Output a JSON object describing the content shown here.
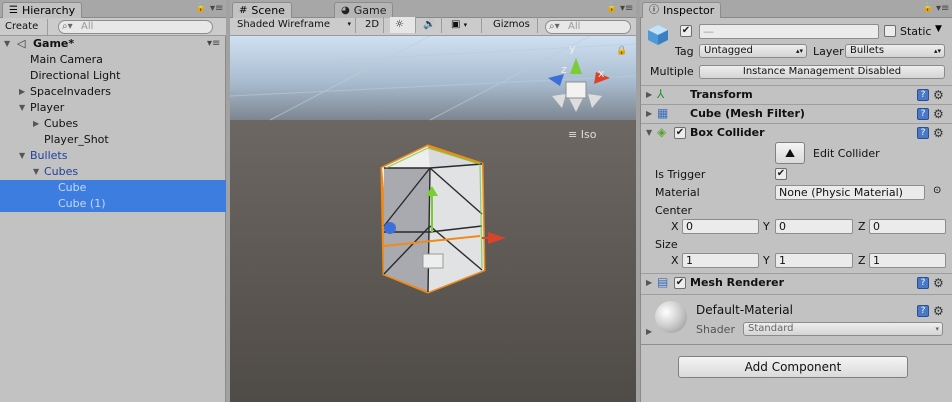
{
  "hierarchy": {
    "tab_label": "Hierarchy",
    "create_label": "Create",
    "search_placeholder": "All",
    "scene_name": "Game*",
    "rows": [
      {
        "label": "Main Camera"
      },
      {
        "label": "Directional Light"
      },
      {
        "label": "SpaceInvaders"
      },
      {
        "label": "Player"
      },
      {
        "label": "Cubes"
      },
      {
        "label": "Player_Shot"
      },
      {
        "label": "Bullets"
      },
      {
        "label": "Cubes"
      },
      {
        "label": "Cube"
      },
      {
        "label": "Cube (1)"
      }
    ]
  },
  "scene": {
    "tab_scene": "Scene",
    "tab_game": "Game",
    "shading_mode": "Shaded Wireframe",
    "mode_2d": "2D",
    "gizmos_label": "Gizmos",
    "search_placeholder": "All",
    "projection_label": "Iso",
    "gizmo_axes": {
      "x": "x",
      "y": "y",
      "z": "z"
    }
  },
  "inspector": {
    "tab_label": "Inspector",
    "object_name": "—",
    "static_label": "Static",
    "tag_label": "Tag",
    "tag_value": "Untagged",
    "layer_label": "Layer",
    "layer_value": "Bullets",
    "multiple_label": "Multiple",
    "instance_management": "Instance Management Disabled",
    "components": {
      "transform": "Transform",
      "mesh_filter": "Cube (Mesh Filter)",
      "box_collider": "Box Collider",
      "mesh_renderer": "Mesh Renderer"
    },
    "box_collider": {
      "edit_collider": "Edit Collider",
      "is_trigger_label": "Is Trigger",
      "material_label": "Material",
      "material_value": "None (Physic Material)",
      "center_label": "Center",
      "center": {
        "x": "0",
        "y": "0",
        "z": "0"
      },
      "size_label": "Size",
      "size": {
        "x": "1",
        "y": "1",
        "z": "1"
      },
      "axis_x": "X",
      "axis_y": "Y",
      "axis_z": "Z"
    },
    "material": {
      "name": "Default-Material",
      "shader_label": "Shader",
      "shader_value": "Standard"
    },
    "add_component": "Add Component"
  },
  "colors": {
    "selection": "#3e7de0",
    "collider_outline": "#f08a1a",
    "gizmo_x": "#d8442a",
    "gizmo_y": "#7ccc33",
    "gizmo_z": "#3c6fd8"
  }
}
